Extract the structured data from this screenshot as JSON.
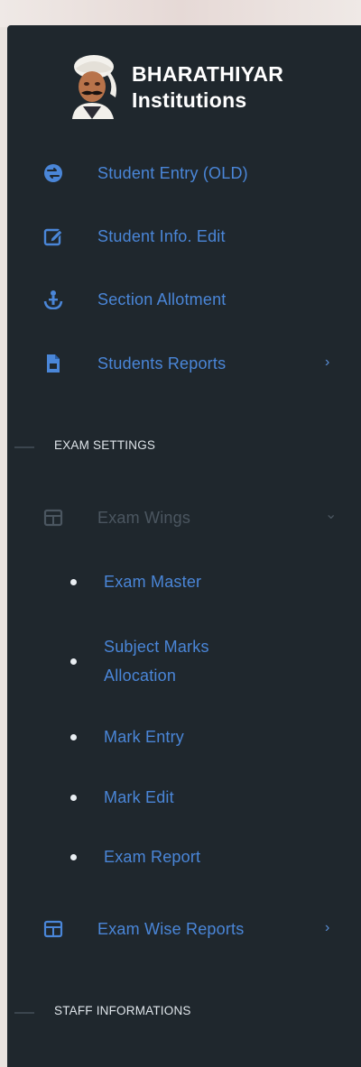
{
  "brand": {
    "line1": "BHARATHIYAR",
    "line2": "Institutions"
  },
  "menu": {
    "items": [
      {
        "label": "Student Entry (OLD)",
        "icon": "exchange-arrows-icon"
      },
      {
        "label": "Student Info. Edit",
        "icon": "edit-square-icon"
      },
      {
        "label": "Section Allotment",
        "icon": "person-anchor-icon"
      },
      {
        "label": "Students Reports",
        "icon": "pdf-file-icon",
        "chevron": "›"
      }
    ],
    "exam_section": "EXAM SETTINGS",
    "exam_wings": {
      "label": "Exam Wings",
      "chevron": "⌄",
      "icon": "layout-grid-icon"
    },
    "exam_sub": [
      {
        "label": "Exam Master"
      },
      {
        "label": "Subject Marks",
        "label2": "Allocation"
      },
      {
        "label": "Mark Entry"
      },
      {
        "label": "Mark Edit"
      },
      {
        "label": "Exam Report"
      }
    ],
    "exam_wise_reports": {
      "label": "Exam Wise Reports",
      "chevron": "›",
      "icon": "layout-grid-icon"
    },
    "staff_section": "STAFF INFORMATIONS"
  },
  "colors": {
    "sidebar_bg": "#1f272d",
    "link": "#4a86d8",
    "disabled": "#4b5660",
    "section_text": "#dfe5ea"
  }
}
